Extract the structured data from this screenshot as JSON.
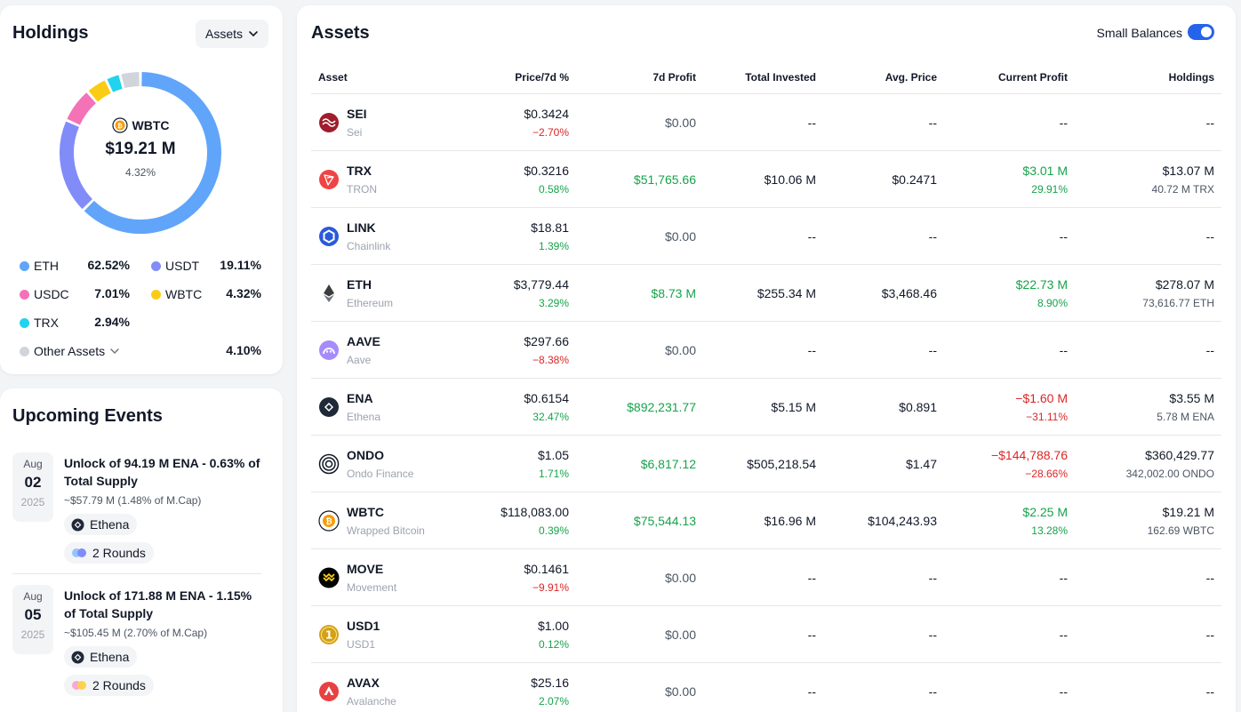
{
  "holdings": {
    "title": "Holdings",
    "dropdown_label": "Assets",
    "center": {
      "asset": "WBTC",
      "value": "$19.21 M",
      "pct": "4.32%"
    },
    "legend": [
      {
        "name": "ETH",
        "pct": "62.52%",
        "color": "#60a5fa"
      },
      {
        "name": "USDT",
        "pct": "19.11%",
        "color": "#818cf8"
      },
      {
        "name": "USDC",
        "pct": "7.01%",
        "color": "#f472b6"
      },
      {
        "name": "WBTC",
        "pct": "4.32%",
        "color": "#facc15"
      },
      {
        "name": "TRX",
        "pct": "2.94%",
        "color": "#22d3ee"
      },
      {
        "name": "Other Assets",
        "pct": "4.10%",
        "color": "#d1d5db"
      }
    ]
  },
  "events": {
    "title": "Upcoming Events",
    "items": [
      {
        "month": "Aug",
        "day": "02",
        "year": "2025",
        "title": "Unlock of 94.19 M ENA - 0.63% of Total Supply",
        "sub": "~$57.79 M (1.48% of M.Cap)",
        "project": "Ethena",
        "rounds": "2 Rounds"
      },
      {
        "month": "Aug",
        "day": "05",
        "year": "2025",
        "title": "Unlock of 171.88 M ENA - 1.15% of Total Supply",
        "sub": "~$105.45 M (2.70% of M.Cap)",
        "project": "Ethena",
        "rounds": "2 Rounds"
      }
    ]
  },
  "assets": {
    "title": "Assets",
    "toggle_label": "Small Balances",
    "toggle_on": true,
    "headers": {
      "asset": "Asset",
      "price": "Price/7d %",
      "profit7d": "7d Profit",
      "invested": "Total Invested",
      "avg": "Avg. Price",
      "current": "Current Profit",
      "holdings": "Holdings"
    },
    "rows": [
      {
        "sym": "SEI",
        "name": "Sei",
        "icon": "sei-icon",
        "color": "#9f1d2c",
        "price": "$0.3424",
        "change": "−2.70%",
        "dir": "neg",
        "profit7d": "$0.00",
        "p7dir": "muted",
        "invested": "--",
        "avg": "--",
        "current": "--",
        "current_pct": "",
        "cdir": "",
        "holdings": "--",
        "holdings_sub": ""
      },
      {
        "sym": "TRX",
        "name": "TRON",
        "icon": "tron-icon",
        "color": "#ef4444",
        "price": "$0.3216",
        "change": "0.58%",
        "dir": "pos",
        "profit7d": "$51,765.66",
        "p7dir": "pos",
        "invested": "$10.06 M",
        "avg": "$0.2471",
        "current": "$3.01 M",
        "current_pct": "29.91%",
        "cdir": "pos",
        "holdings": "$13.07 M",
        "holdings_sub": "40.72 M TRX"
      },
      {
        "sym": "LINK",
        "name": "Chainlink",
        "icon": "chainlink-icon",
        "color": "#2a5ada",
        "price": "$18.81",
        "change": "1.39%",
        "dir": "pos",
        "profit7d": "$0.00",
        "p7dir": "muted",
        "invested": "--",
        "avg": "--",
        "current": "--",
        "current_pct": "",
        "cdir": "",
        "holdings": "--",
        "holdings_sub": ""
      },
      {
        "sym": "ETH",
        "name": "Ethereum",
        "icon": "ethereum-icon",
        "color": "#3c3c3d",
        "price": "$3,779.44",
        "change": "3.29%",
        "dir": "pos",
        "profit7d": "$8.73 M",
        "p7dir": "pos",
        "invested": "$255.34 M",
        "avg": "$3,468.46",
        "current": "$22.73 M",
        "current_pct": "8.90%",
        "cdir": "pos",
        "holdings": "$278.07 M",
        "holdings_sub": "73,616.77 ETH"
      },
      {
        "sym": "AAVE",
        "name": "Aave",
        "icon": "aave-icon",
        "color": "#a78bfa",
        "price": "$297.66",
        "change": "−8.38%",
        "dir": "neg",
        "profit7d": "$0.00",
        "p7dir": "muted",
        "invested": "--",
        "avg": "--",
        "current": "--",
        "current_pct": "",
        "cdir": "",
        "holdings": "--",
        "holdings_sub": ""
      },
      {
        "sym": "ENA",
        "name": "Ethena",
        "icon": "ethena-icon",
        "color": "#1f2937",
        "price": "$0.6154",
        "change": "32.47%",
        "dir": "pos",
        "profit7d": "$892,231.77",
        "p7dir": "pos",
        "invested": "$5.15 M",
        "avg": "$0.891",
        "current": "−$1.60 M",
        "current_pct": "−31.11%",
        "cdir": "neg",
        "holdings": "$3.55 M",
        "holdings_sub": "5.78 M ENA"
      },
      {
        "sym": "ONDO",
        "name": "Ondo Finance",
        "icon": "ondo-icon",
        "color": "#111827",
        "price": "$1.05",
        "change": "1.71%",
        "dir": "pos",
        "profit7d": "$6,817.12",
        "p7dir": "pos",
        "invested": "$505,218.54",
        "avg": "$1.47",
        "current": "−$144,788.76",
        "current_pct": "−28.66%",
        "cdir": "neg",
        "holdings": "$360,429.77",
        "holdings_sub": "342,002.00 ONDO"
      },
      {
        "sym": "WBTC",
        "name": "Wrapped Bitcoin",
        "icon": "wbtc-icon",
        "color": "#f59e0b",
        "price": "$118,083.00",
        "change": "0.39%",
        "dir": "pos",
        "profit7d": "$75,544.13",
        "p7dir": "pos",
        "invested": "$16.96 M",
        "avg": "$104,243.93",
        "current": "$2.25 M",
        "current_pct": "13.28%",
        "cdir": "pos",
        "holdings": "$19.21 M",
        "holdings_sub": "162.69 WBTC"
      },
      {
        "sym": "MOVE",
        "name": "Movement",
        "icon": "movement-icon",
        "color": "#000000",
        "price": "$0.1461",
        "change": "−9.91%",
        "dir": "neg",
        "profit7d": "$0.00",
        "p7dir": "muted",
        "invested": "--",
        "avg": "--",
        "current": "--",
        "current_pct": "",
        "cdir": "",
        "holdings": "--",
        "holdings_sub": ""
      },
      {
        "sym": "USD1",
        "name": "USD1",
        "icon": "usd1-icon",
        "color": "#d4a017",
        "price": "$1.00",
        "change": "0.12%",
        "dir": "pos",
        "profit7d": "$0.00",
        "p7dir": "muted",
        "invested": "--",
        "avg": "--",
        "current": "--",
        "current_pct": "",
        "cdir": "",
        "holdings": "--",
        "holdings_sub": ""
      },
      {
        "sym": "AVAX",
        "name": "Avalanche",
        "icon": "avalanche-icon",
        "color": "#e84142",
        "price": "$25.16",
        "change": "2.07%",
        "dir": "pos",
        "profit7d": "$0.00",
        "p7dir": "muted",
        "invested": "--",
        "avg": "--",
        "current": "--",
        "current_pct": "",
        "cdir": "",
        "holdings": "--",
        "holdings_sub": ""
      }
    ]
  }
}
